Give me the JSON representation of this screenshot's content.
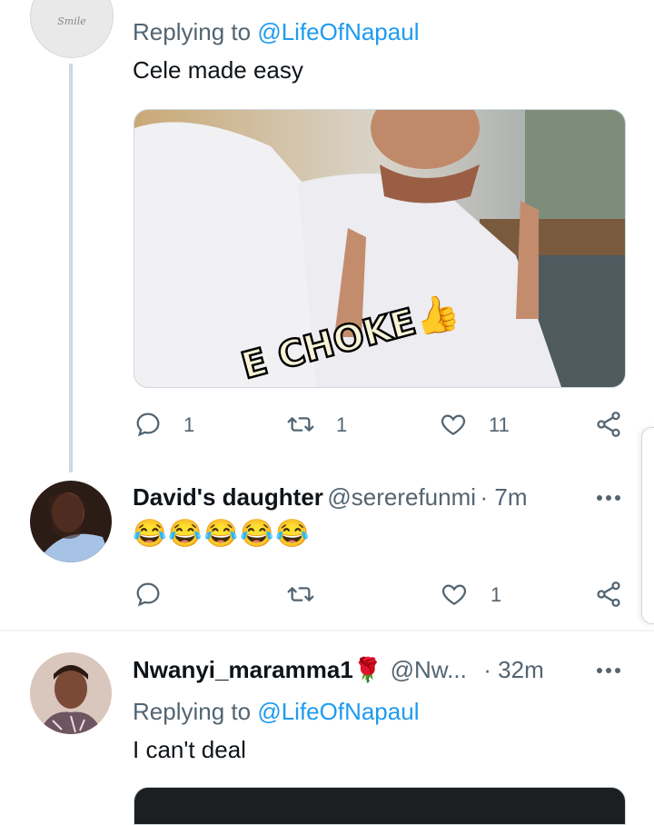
{
  "tweet1": {
    "avatar_text": "Smile",
    "replying_prefix": "Replying to",
    "replying_handle": "@LifeOfNapaul",
    "text": "Cele made easy",
    "image_caption": "E CHOKE👍",
    "actions": {
      "reply": "1",
      "retweet": "1",
      "like": "11"
    }
  },
  "tweet2": {
    "name": "David's daughter",
    "handle": "@sererefunmi",
    "time": "· 7m",
    "emojis": "😂😂😂😂😂",
    "actions": {
      "reply": "",
      "retweet": "",
      "like": "1"
    }
  },
  "tweet3": {
    "name": "Nwanyi_maramma1🌹",
    "handle": "@Nw...",
    "time": "· 32m",
    "replying_prefix": "Replying to",
    "replying_handle": "@LifeOfNapaul",
    "text": "I can't deal"
  },
  "colors": {
    "accent": "#1d9bf0",
    "muted": "#536471",
    "like_red": "#f91880"
  }
}
